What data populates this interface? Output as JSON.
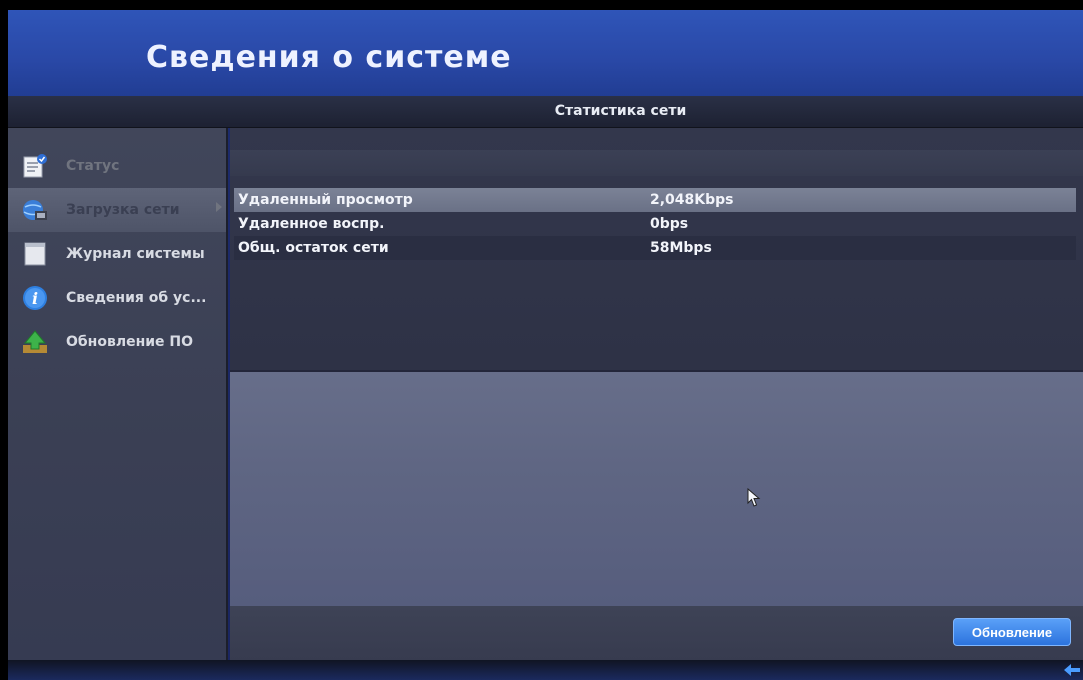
{
  "header": {
    "title": "Сведения о системе"
  },
  "subheader": {
    "title": "Статистика сети"
  },
  "sidebar": {
    "items": [
      {
        "label": "Статус",
        "icon": "status-icon"
      },
      {
        "label": "Загрузка сети",
        "icon": "network-icon"
      },
      {
        "label": "Журнал системы",
        "icon": "log-icon"
      },
      {
        "label": "Сведения об ус...",
        "icon": "info-icon"
      },
      {
        "label": "Обновление ПО",
        "icon": "upgrade-icon"
      }
    ]
  },
  "table": {
    "rows": [
      {
        "name": "Удаленный просмотр",
        "value": "2,048Kbps"
      },
      {
        "name": "Удаленное воспр.",
        "value": "0bps"
      },
      {
        "name": "Общ. остаток сети",
        "value": "58Mbps"
      }
    ]
  },
  "footer": {
    "refresh_label": "Обновление"
  },
  "colors": {
    "accent": "#2c73de",
    "header": "#2f55b8",
    "panel": "#33374c"
  }
}
